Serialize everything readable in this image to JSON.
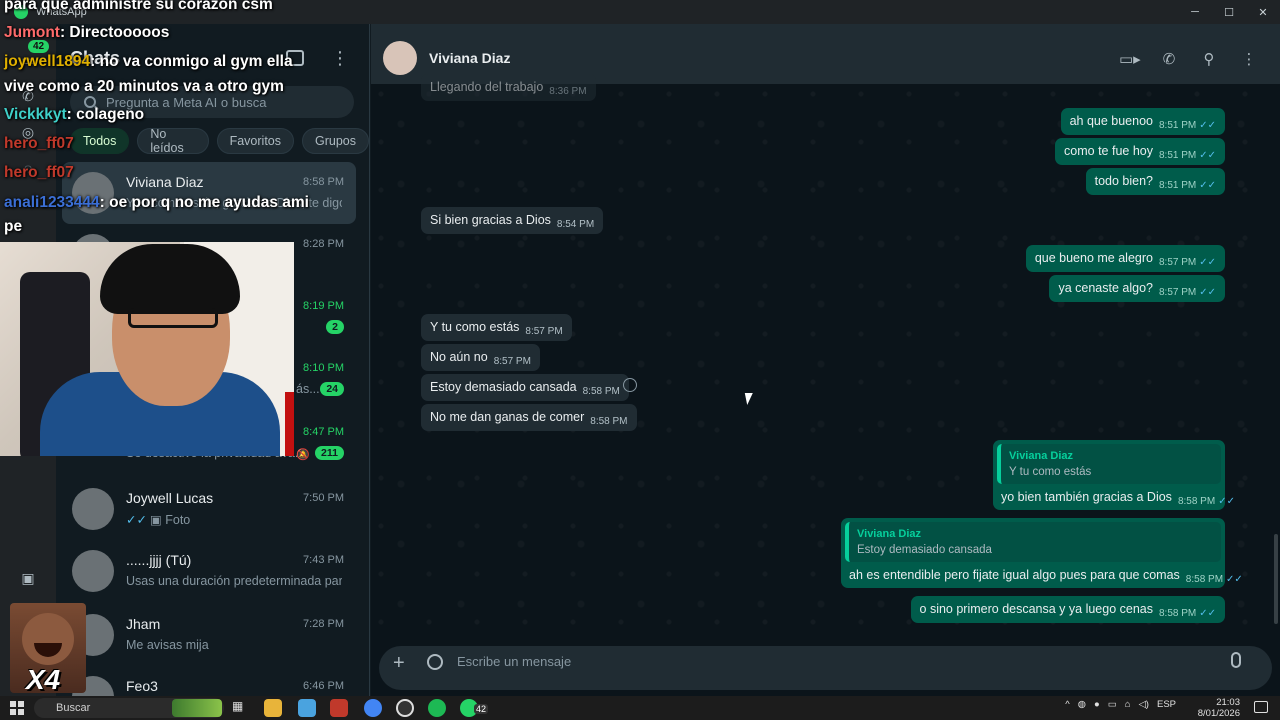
{
  "titlebar": {
    "app_name": "WhatsApp",
    "minimize": "─",
    "maximize": "☐",
    "close": "✕"
  },
  "rail": {
    "chats_badge": "42"
  },
  "chatlist": {
    "title": "Chats",
    "search_placeholder": "Pregunta a Meta AI o busca",
    "filters": [
      "Todos",
      "No leídos",
      "Favoritos",
      "Grupos"
    ],
    "items": [
      {
        "name": "Viviana Diaz",
        "time": "8:58 PM",
        "preview": "Y tu como estás, gracias a Dios, te digo...",
        "selected": true
      },
      {
        "name": "",
        "time": "8:28 PM",
        "preview": ""
      },
      {
        "name": "",
        "time": "8:19 PM",
        "preview": "",
        "unread": "2"
      },
      {
        "name": "",
        "time": "8:10 PM",
        "preview": "ás...",
        "unread": "24"
      },
      {
        "name": "",
        "time": "8:47 PM",
        "preview": "Se desactivó la privacidad ava...",
        "unread": "211"
      },
      {
        "name": "Joywell Lucas",
        "time": "7:50 PM",
        "preview": "Foto"
      },
      {
        "name": "......jjjj (Tú)",
        "time": "7:43 PM",
        "preview": "Usas una duración predeterminada par..."
      },
      {
        "name": "Jham",
        "time": "7:28 PM",
        "preview": "Me avisas mija"
      },
      {
        "name": "Feo3",
        "time": "6:46 PM",
        "preview": ""
      }
    ]
  },
  "stream_chat": [
    {
      "user": "",
      "text": "para que administre su corazón csm",
      "color": "#ffffff"
    },
    {
      "user": "Jumont",
      "text": ": Directooooos",
      "color": "#ff6b6b"
    },
    {
      "user": "joywell1894",
      "text": ": no va conmigo al gym ella",
      "color": "#e0b000"
    },
    {
      "user": "",
      "text": "vive como a 20 minutos va a otro gym",
      "color": "#ffffff"
    },
    {
      "user": "Vickkkyt",
      "text": ": colageno",
      "color": "#3fd0c9"
    },
    {
      "user": "hero_ff07",
      "text": "",
      "color": "#c0392b"
    },
    {
      "user": "hero_ff07",
      "text": "",
      "color": "#c0392b"
    },
    {
      "user": "anali1233444",
      "text": ": oe por q no me ayudas ami",
      "color": "#3b6fd6"
    },
    {
      "user": "",
      "text": "pe",
      "color": "#ffffff"
    }
  ],
  "overlay": {
    "multiplier": "X4"
  },
  "conversation": {
    "contact_name": "Viviana Diaz",
    "partial_top": {
      "text": "Llegando del trabajo",
      "time": "8:36 PM"
    },
    "messages": [
      {
        "dir": "out",
        "text": "ah que buenoo",
        "time": "8:51 PM"
      },
      {
        "dir": "out",
        "text": "como te fue hoy",
        "time": "8:51 PM"
      },
      {
        "dir": "out",
        "text": "todo bien?",
        "time": "8:51 PM"
      },
      {
        "dir": "in",
        "text": "Si bien gracias a Dios",
        "time": "8:54 PM"
      },
      {
        "dir": "out",
        "text": "que bueno me alegro",
        "time": "8:57 PM"
      },
      {
        "dir": "out",
        "text": "ya cenaste algo?",
        "time": "8:57 PM"
      },
      {
        "dir": "in",
        "text": "Y tu como estás",
        "time": "8:57 PM"
      },
      {
        "dir": "in",
        "text": "No aún no",
        "time": "8:57 PM"
      },
      {
        "dir": "in",
        "text": "Estoy demasiado cansada",
        "time": "8:58 PM"
      },
      {
        "dir": "in",
        "text": "No me dan ganas de comer",
        "time": "8:58 PM"
      },
      {
        "dir": "out",
        "quote_name": "Viviana Diaz",
        "quote_text": "Y tu como estás",
        "text": "yo bien también gracias a Dios",
        "time": "8:58 PM"
      },
      {
        "dir": "out",
        "quote_name": "Viviana Diaz",
        "quote_text": "Estoy demasiado cansada",
        "text": "ah es entendible pero fijate igual algo pues para que comas",
        "time": "8:58 PM"
      },
      {
        "dir": "out",
        "text": "o sino primero descansa y ya luego cenas",
        "time": "8:58 PM"
      }
    ],
    "composer_placeholder": "Escribe un mensaje",
    "read_ticks": "✓✓"
  },
  "taskbar": {
    "search": "Buscar",
    "whatsapp_badge": "42",
    "lang": "ESP",
    "time": "21:03",
    "date": "8/01/2026"
  },
  "icons": {
    "video": "video-call-icon",
    "phone": "phone-icon",
    "search": "search-icon",
    "menu": "menu-icon"
  }
}
